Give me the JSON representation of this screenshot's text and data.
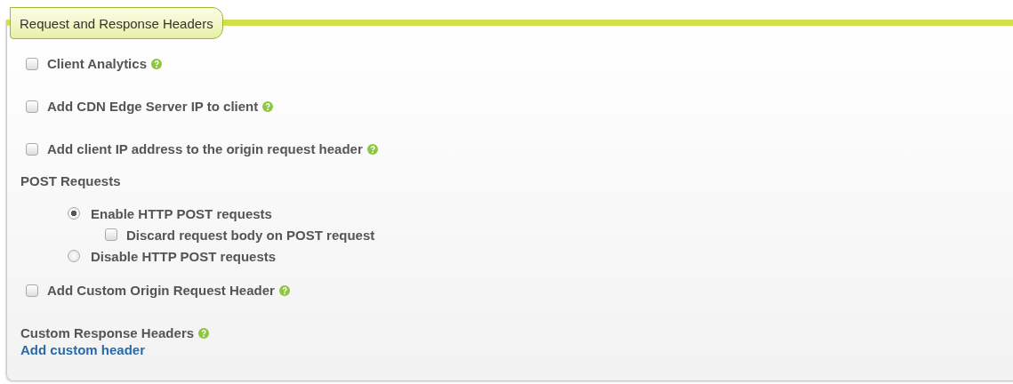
{
  "section": {
    "title": "Request and Response Headers"
  },
  "items": [
    {
      "kind": "checkbox",
      "label": "Client Analytics",
      "checked": false,
      "help": true
    },
    {
      "kind": "checkbox",
      "label": "Add CDN Edge Server IP to client",
      "checked": false,
      "help": true
    },
    {
      "kind": "checkbox",
      "label": "Add client IP address to the origin request header",
      "checked": false,
      "help": true
    },
    {
      "kind": "radio-group",
      "label": "POST Requests",
      "choices": [
        {
          "label": "Enable HTTP POST requests",
          "selected": true,
          "children": [
            {
              "label": "Discard request body on POST request",
              "checked": false
            }
          ]
        },
        {
          "label": "Disable HTTP POST requests",
          "selected": false
        }
      ]
    },
    {
      "kind": "checkbox",
      "label": "Add Custom Origin Request Header",
      "checked": false,
      "help": true
    },
    {
      "kind": "link-group",
      "label": "Custom Response Headers",
      "help": true,
      "link": "Add custom header"
    }
  ]
}
